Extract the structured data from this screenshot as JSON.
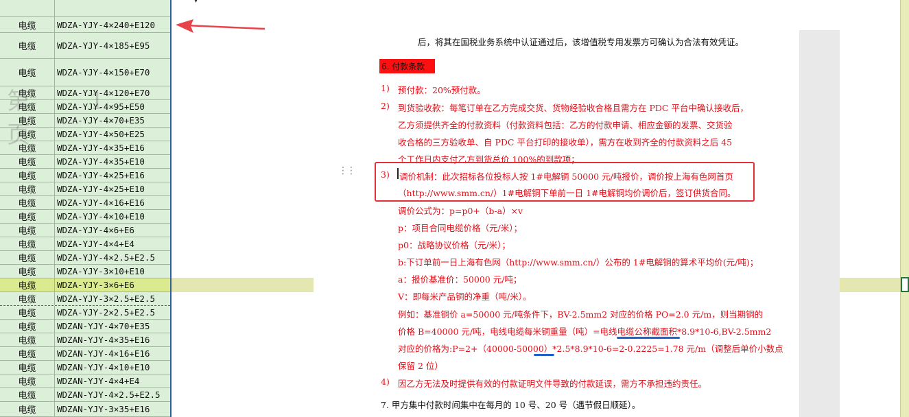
{
  "sheet": {
    "rows": [
      {
        "a": "电缆",
        "b": "WDZA-YJY-4×240+E120"
      },
      {
        "a": "电缆",
        "b": "WDZA-YJY-4×185+E95"
      },
      {
        "a": "电缆",
        "b": "WDZA-YJY-4×150+E70"
      },
      {
        "a": "电缆",
        "b": "WDZA-YJY-4×120+E70"
      },
      {
        "a": "电缆",
        "b": "WDZA-YJY-4×95+E50"
      },
      {
        "a": "电缆",
        "b": "WDZA-YJY-4×70+E35"
      },
      {
        "a": "电缆",
        "b": "WDZA-YJY-4×50+E25"
      },
      {
        "a": "电缆",
        "b": "WDZA-YJY-4×35+E16"
      },
      {
        "a": "电缆",
        "b": "WDZA-YJY-4×35+E10"
      },
      {
        "a": "电缆",
        "b": "WDZA-YJY-4×25+E16"
      },
      {
        "a": "电缆",
        "b": "WDZA-YJY-4×25+E10"
      },
      {
        "a": "电缆",
        "b": "WDZA-YJY-4×16+E16"
      },
      {
        "a": "电缆",
        "b": "WDZA-YJY-4×10+E10"
      },
      {
        "a": "电缆",
        "b": "WDZA-YJY-4×6+E6"
      },
      {
        "a": "电缆",
        "b": "WDZA-YJY-4×4+E4"
      },
      {
        "a": "电缆",
        "b": "WDZA-YJY-4×2.5+E2.5"
      },
      {
        "a": "电缆",
        "b": "WDZA-YJY-3×10+E10"
      },
      {
        "a": "电缆",
        "b": "WDZA-YJY-3×6+E6"
      },
      {
        "a": "电缆",
        "b": "WDZA-YJY-3×2.5+E2.5"
      },
      {
        "a": "电缆",
        "b": "WDZA-YJY-2×2.5+E2.5"
      },
      {
        "a": "电缆",
        "b": "WDZAN-YJY-4×70+E35"
      },
      {
        "a": "电缆",
        "b": "WDZAN-YJY-4×35+E16"
      },
      {
        "a": "电缆",
        "b": "WDZAN-YJY-4×16+E16"
      },
      {
        "a": "电缆",
        "b": "WDZAN-YJY-4×10+E10"
      },
      {
        "a": "电缆",
        "b": "WDZAN-YJY-4×4+E4"
      },
      {
        "a": "电缆",
        "b": "WDZAN-YJY-4×2.5+E2.5"
      },
      {
        "a": "电缆",
        "b": "WDZAN-YJY-3×35+E16"
      }
    ],
    "ghost_text": "第 1 页"
  },
  "doc": {
    "line0": "后，将其在国税业务系统中认证通过后，该增值税专用发票方可确认为合法有效凭证。",
    "heading": "6.  付款条款",
    "i1_num": "1)",
    "i1": "预付款：20%预付款。",
    "i2_num": "2)",
    "i2_l1": "到货验收款：每笔订单在乙方完成交货、货物经验收合格且需方在 PDC 平台中确认接收后，",
    "i2_l2": "乙方须提供齐全的付款资料（付款资料包括：乙方的付款申请、相应金额的发票、交货验",
    "i2_l3": "收合格的三方验收单、自 PDC 平台打印的接收单），需方在收到齐全的付款资料之后 45",
    "i2_l4": "个工作日内支付乙方到货总价 100%的到款项；",
    "i3_num": "3)",
    "i3_l1": "调价机制：此次招标各位投标人按 1#电解铜 50000 元/吨报价，调价按上海有色网首页",
    "i3_l2": "（http://www.smm.cn/）1#电解铜下单前一日 1#电解铜均价调价后，签订供货合同。",
    "f1": "调价公式为：p=p0+（b-a）×v",
    "f2": "p：项目合同电缆价格（元/米）；",
    "f3": "p0：战略协议价格（元/米）；",
    "f4": "b:下订单前一日上海有色网（http://www.smm.cn/）公布的 1#电解铜的算术平均价(元/吨)；",
    "f5": "a：报价基准价：50000 元/吨；",
    "f6": "V：即每米产品铜的净重（吨/米）。",
    "e1": "例如：基准铜价 a=50000 元/吨条件下，BV-2.5mm2 对应的价格 PO=2.0 元/m，则当期铜的",
    "e2": "价格 B=40000 元/吨，电线电缆每米铜重量（吨）=电线电缆公称截面积*8.9*10-6,BV-2.5mm2",
    "e3": "对应的价格为:P=2+（40000-50000）*2.5*8.9*10-6=2-0.2225=1.78 元/m（调整后单价小数点",
    "e4": "保留 2 位）",
    "i4_num": "4)",
    "i4": "因乙方无法及时提供有效的付款证明文件导致的付款延误，需方不承担违约责任。",
    "s7": "7.  甲方集中付款时间集中在每月的 10 号、20 号（遇节假日顺延）。"
  },
  "colors": {
    "sheet_bg": "#dcefd9",
    "selected_row": "#d9ea8f",
    "doc_red": "#e0101a",
    "highlight_box": "#e0303a",
    "underline_blue": "#1e63c7",
    "arrow": "#e8434a"
  },
  "icons": {
    "drag_handle": "⋮⋮",
    "chevron": "▾"
  }
}
